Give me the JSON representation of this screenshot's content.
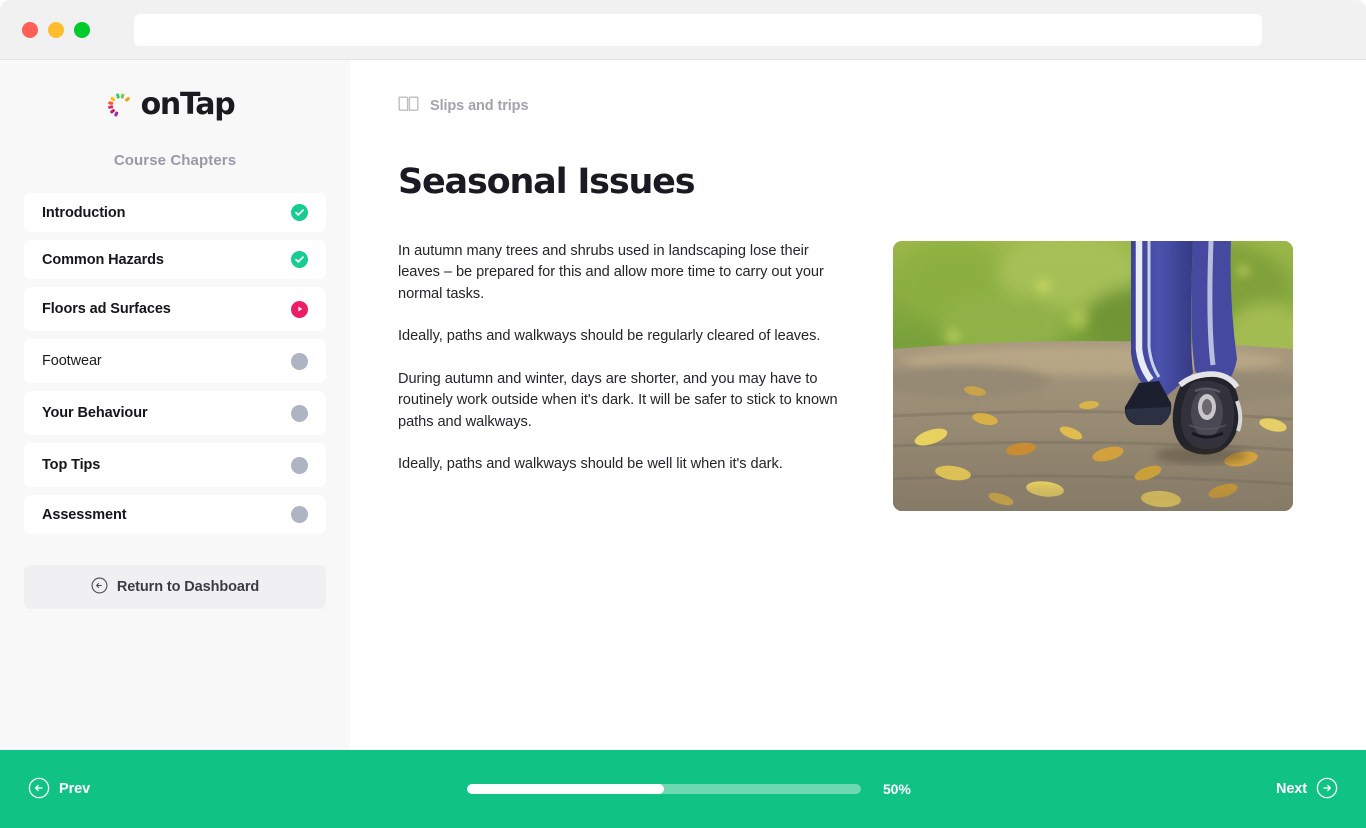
{
  "browser": {
    "url_value": "",
    "url_placeholder": "",
    "traffic_lights": [
      {
        "name": "close",
        "color": "#ff5f57"
      },
      {
        "name": "minimize",
        "color": "#ffbd2e"
      },
      {
        "name": "maximize",
        "color": "#00ca2c"
      }
    ]
  },
  "sidebar": {
    "logo_text": "onTap",
    "logo_burst_colors": [
      "#2ecc71",
      "#8bc34a",
      "#ffc107",
      "#ff9800",
      "#ff5722",
      "#e91e63",
      "#c2185b",
      "#9c27b0"
    ],
    "section_label": "Course Chapters",
    "chapters": [
      {
        "label": "Introduction",
        "status": "done",
        "icon": "check-circle-icon"
      },
      {
        "label": "Common Hazards",
        "status": "done",
        "icon": "check-circle-icon"
      },
      {
        "label": "Floors ad Surfaces",
        "status": "current",
        "icon": "play-circle-icon"
      },
      {
        "label": "Footwear",
        "status": "pending",
        "icon": "dot-circle-icon"
      },
      {
        "label": "Your Behaviour",
        "status": "pending",
        "icon": "dot-circle-icon"
      },
      {
        "label": "Top Tips",
        "status": "pending",
        "icon": "dot-circle-icon"
      },
      {
        "label": "Assessment",
        "status": "pending",
        "icon": "dot-circle-icon"
      }
    ],
    "return_button": "Return to Dashboard"
  },
  "main": {
    "breadcrumb": "Slips and trips",
    "title": "Seasonal Issues",
    "paragraphs": [
      "In autumn many trees and shrubs used in landscaping lose their leaves – be prepared for this and allow more time to carry out your normal tasks.",
      "Ideally, paths and walkways should be regularly cleared of leaves.",
      "During autumn and winter, days are shorter, and you may have to routinely work outside when it's dark. It will be safer to stick to known paths and walkways.",
      "Ideally, paths and walkways should be well lit when it's dark."
    ],
    "image_alt": "Person walking on a leaf-covered path in autumn"
  },
  "footer": {
    "prev_label": "Prev",
    "next_label": "Next",
    "progress_percent": 50,
    "progress_label": "50%",
    "bar_color": "#11c285"
  },
  "colors": {
    "accent_green": "#17cd8d",
    "accent_pink": "#ee1c62",
    "pending_gray": "#aeb4c2",
    "footer_green": "#11c285",
    "sidebar_bg": "#f8f8f9"
  }
}
